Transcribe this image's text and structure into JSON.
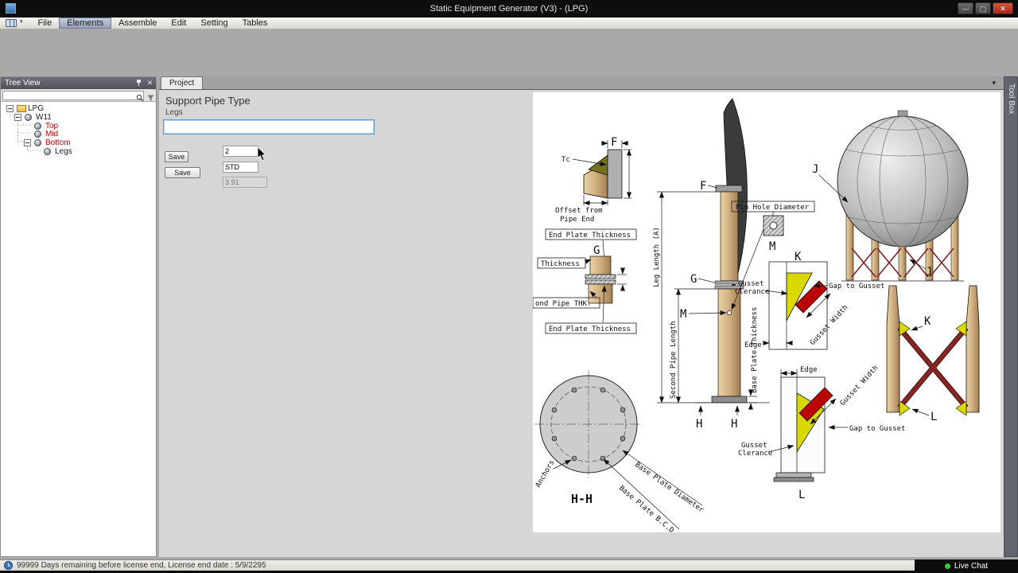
{
  "titlebar": {
    "title": "Static Equipment Generator (V3) - (LPG)"
  },
  "icons": {
    "chevron_down": "▾",
    "close": "✕",
    "minimize": "—",
    "maximize": "▢"
  },
  "menubar": {
    "file": "File",
    "elements": "Elements",
    "assemble": "Assemble",
    "edit": "Edit",
    "setting": "Setting",
    "tables": "Tables"
  },
  "tree_panel": {
    "title": "Tree View",
    "search_value": "",
    "nodes": {
      "root": "LPG",
      "vessel": "W11",
      "top": "Top",
      "mid": "Mid",
      "bottom": "Bottom",
      "legs": "Legs"
    }
  },
  "main": {
    "tab_project": "Project",
    "form": {
      "title": "Support Pipe Type",
      "field_label": "Legs",
      "main_input_value": "",
      "save1": "Save",
      "save2": "Save",
      "qty_value": "2",
      "type_value": "STD",
      "readonly_value": "3.91"
    }
  },
  "toolbox": {
    "title": "Tool Box"
  },
  "statusbar": {
    "license": "99999 Days remaining before license end, License end date : 5/9/2295",
    "live_chat": "Live Chat"
  },
  "diagram": {
    "detail_f": {
      "label": "F",
      "tc": "Tc",
      "offset_line1": "Offset from",
      "offset_line2": "Pipe End"
    },
    "detail_g": {
      "label": "G",
      "end_plate_top": "End Plate Thickness",
      "thickness": "Thickness",
      "second_pipe_thk": "ond Pipe THK.",
      "end_plate_bottom": "End Plate Thickness"
    },
    "leg": {
      "label_f": "F",
      "label_g": "G",
      "label_m": "M",
      "label_h_left": "H",
      "label_h_right": "H",
      "leg_length": "Leg Length (A)",
      "second_pipe_length": "Second Pipe Length",
      "base_plate_thickness": "Base Plate Thickness"
    },
    "pin_detail": {
      "title": "Pin Hole Diameter",
      "label": "M"
    },
    "sphere": {
      "label_j_top": "J",
      "label_j_bottom": "J"
    },
    "detail_k": {
      "label": "K",
      "gusset_clearance_line1": "Gusset",
      "gusset_clearance_line2": "Clerance",
      "gap_to_gusset": "Gap to Gusset",
      "gusset_width": "Gusset Width",
      "edge": "Edge"
    },
    "bracing": {
      "label_k": "K",
      "label_l": "L"
    },
    "base_plan": {
      "anchors": "Anchors",
      "base_plate_diameter": "Base Plate Diameter",
      "base_plate_bcd": "Base Plate B.C.D",
      "section": "H-H"
    },
    "detail_l": {
      "label": "L",
      "edge": "Edge",
      "gusset_width": "Gusset Width",
      "gap_to_gusset": "Gap to Gusset",
      "gusset_clearance_line1": "Gusset",
      "gusset_clearance_line2": "Clerance"
    }
  }
}
